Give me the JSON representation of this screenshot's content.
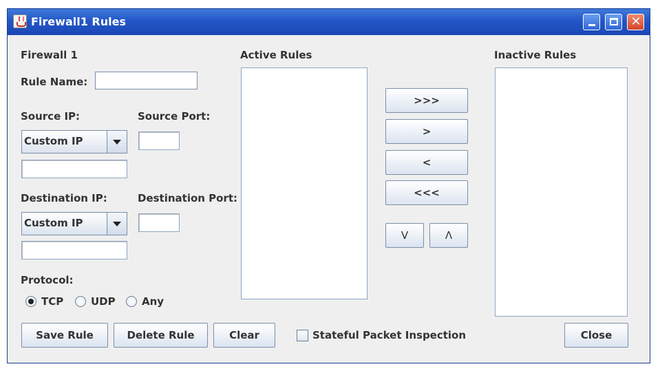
{
  "window": {
    "title": "Firewall1 Rules"
  },
  "form": {
    "firewall_name": "Firewall 1",
    "rule_name_label": "Rule Name:",
    "rule_name_value": "",
    "source_ip_label": "Source IP:",
    "source_ip_selected": "Custom IP",
    "source_ip_value": "",
    "source_port_label": "Source Port:",
    "source_port_value": "",
    "destination_ip_label": "Destination IP:",
    "destination_ip_selected": "Custom IP",
    "destination_ip_value": "",
    "destination_port_label": "Destination Port:",
    "destination_port_value": "",
    "protocol_label": "Protocol:",
    "protocols": [
      {
        "label": "TCP",
        "selected": true
      },
      {
        "label": "UDP",
        "selected": false
      },
      {
        "label": "Any",
        "selected": false
      }
    ]
  },
  "lists": {
    "active_label": "Active Rules",
    "inactive_label": "Inactive Rules",
    "active_items": [],
    "inactive_items": []
  },
  "transfer_buttons": {
    "move_all_right": ">>>",
    "move_right": ">",
    "move_left": "<",
    "move_all_left": "<<<",
    "move_down": "V",
    "move_up": "Λ"
  },
  "actions": {
    "save": "Save Rule",
    "delete": "Delete Rule",
    "clear": "Clear",
    "stateful_label": "Stateful Packet Inspection",
    "stateful_checked": false,
    "close": "Close"
  },
  "icons": {
    "app": "java-icon",
    "minimize": "minimize-icon",
    "maximize": "maximize-icon",
    "close": "close-icon"
  }
}
